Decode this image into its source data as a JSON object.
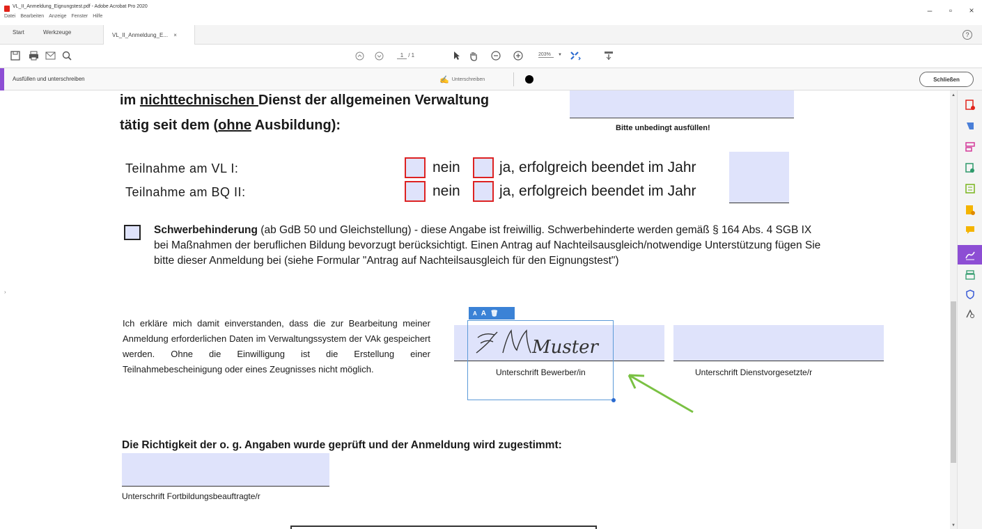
{
  "window": {
    "title": "VL_II_Anmeldung_Eignungstest.pdf - Adobe Acrobat Pro 2020",
    "menu": [
      "Datei",
      "Bearbeiten",
      "Anzeige",
      "Fenster",
      "Hilfe"
    ],
    "controls": {
      "minimize": "–",
      "maximize": "▫",
      "close": "×"
    }
  },
  "tabs": {
    "start": "Start",
    "tools": "Werkzeuge",
    "document": "VL_II_Anmeldung_E...",
    "close": "×",
    "help": "?"
  },
  "toolbar": {
    "page_current": "1",
    "page_total": "/ 1",
    "zoom": "203%"
  },
  "fill_sign": {
    "title": "Ausfüllen und unterschreiben",
    "sign_label": "Unterschreiben",
    "close_label": "Schließen"
  },
  "document": {
    "line1_prefix": "im ",
    "line1_underlined": "nichttechnischen ",
    "line1_suffix": "Dienst der allgemeinen Verwaltung",
    "line2_prefix": "tätig seit dem (",
    "line2_underlined": "ohne",
    "line2_suffix": " Ausbildung):",
    "must_fill_note": "Bitte unbedingt ausfüllen!",
    "rows": [
      {
        "label": "Teilnahme am VL I:",
        "no": "nein",
        "yes": "ja, erfolgreich beendet im Jahr"
      },
      {
        "label": "Teilnahme am BQ II:",
        "no": "nein",
        "yes": "ja, erfolgreich beendet im Jahr"
      }
    ],
    "disability_bold": "Schwerbehinderung",
    "disability_text": " (ab GdB 50 und Gleichstellung) - diese Angabe ist freiwillig. Schwerbehinderte werden gemäß § 164 Abs. 4 SGB IX bei Maßnahmen der beruflichen Bildung bevorzugt berücksichtigt. Einen Antrag auf Nachteilsausgleich/notwendige Unterstützung fügen Sie bitte dieser Anmeldung bei (siehe Formular \"Antrag auf Nachteilsausgleich für den Eignungstest\")",
    "consent": "Ich erkläre mich damit einverstanden, dass die zur Bearbeitung meiner Anmeldung erforderlichen Daten im Verwaltungssystem der VAk gespeichert werden. Ohne die Einwilligung ist die Erstellung einer Teilnahmebescheinigung oder eines Zeugnisses nicht möglich.",
    "signature_applicant_label": "Unterschrift Bewerber/in",
    "signature_supervisor_label": "Unterschrift Dienstvorgesetzte/r",
    "signature_text": "Muster",
    "approve_heading": "Die Richtigkeit der o. g. Angaben wurde geprüft und der Anmeldung wird zugestimmt:",
    "approve_label": "Unterschrift Fortbildungsbeauftragte/r"
  },
  "selection_toolbar": {
    "decrease": "A",
    "increase": "A",
    "delete": "🗑"
  },
  "colors": {
    "accent": "#8d4ed4",
    "field": "#dfe3fb",
    "checkbox_border": "#dd2222",
    "arrow": "#7ac143",
    "selection": "#3b82d6"
  },
  "right_tools": [
    "pdf-create-icon",
    "export-icon",
    "organize-icon",
    "combine-icon",
    "edit-icon",
    "redact-icon",
    "comment-icon",
    "fill-sign-icon",
    "print-icon",
    "protect-icon",
    "more-tools-icon"
  ]
}
